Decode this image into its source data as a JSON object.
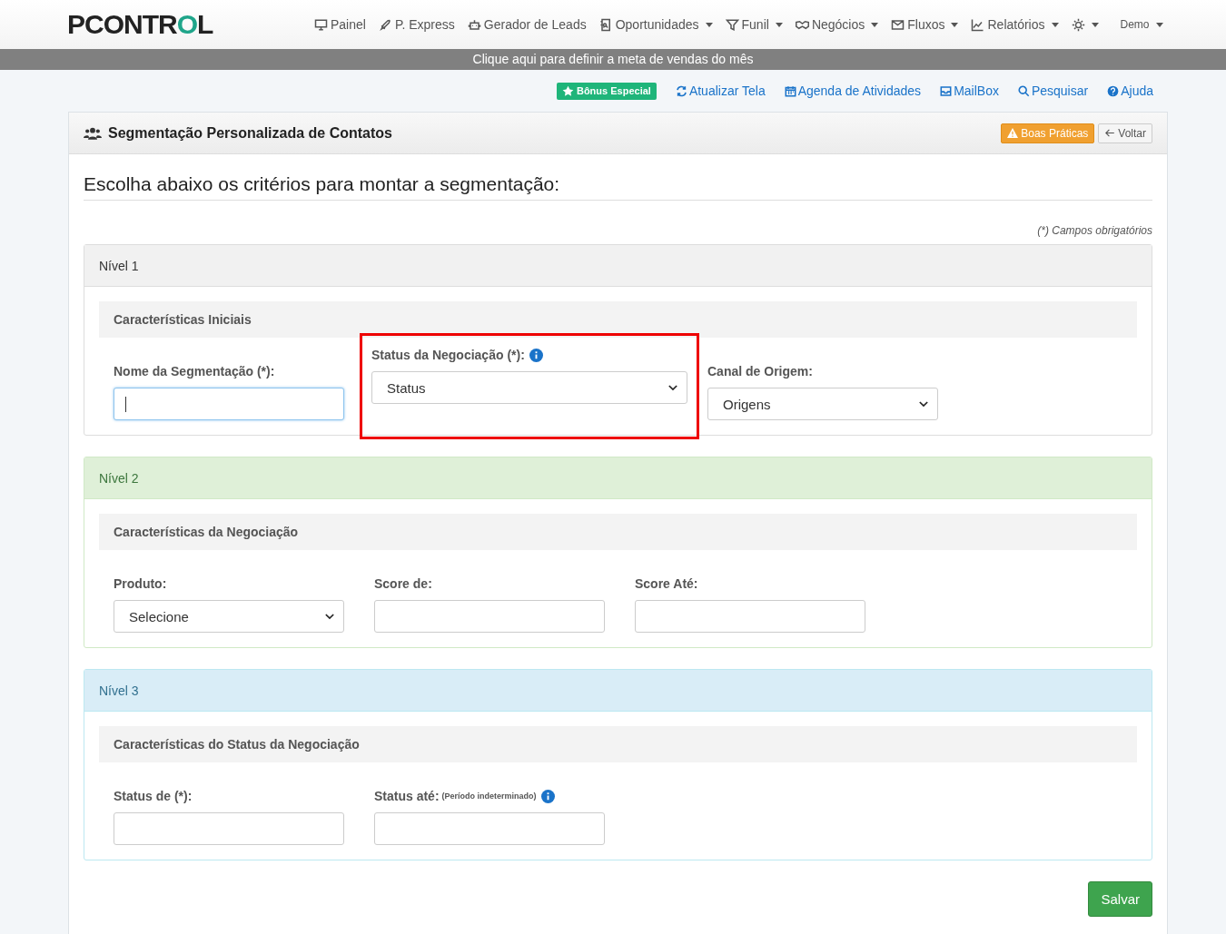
{
  "logo": {
    "text": "PCONTROL"
  },
  "nav": [
    {
      "label": "Painel",
      "dropdown": false
    },
    {
      "label": "P. Express",
      "dropdown": false
    },
    {
      "label": "Gerador de Leads",
      "dropdown": false
    },
    {
      "label": "Oportunidades",
      "dropdown": true
    },
    {
      "label": "Funil",
      "dropdown": true
    },
    {
      "label": "Negócios",
      "dropdown": true
    },
    {
      "label": "Fluxos",
      "dropdown": true
    },
    {
      "label": "Relatórios",
      "dropdown": true
    },
    {
      "dropdown": true
    },
    {
      "label": "Demo",
      "dropdown": true
    }
  ],
  "banner": "Clique aqui para definir a meta de vendas do mês",
  "toolbar": [
    {
      "label": "Bônus Especial",
      "kind": "badge"
    },
    {
      "label": "Atualizar Tela",
      "kind": "link"
    },
    {
      "label": "Agenda de Atividades",
      "kind": "link"
    },
    {
      "label": "MailBox",
      "kind": "link"
    },
    {
      "label": "Pesquisar",
      "kind": "link"
    },
    {
      "label": "Ajuda",
      "kind": "link"
    }
  ],
  "card": {
    "title": "Segmentação Personalizada de Contatos",
    "buttons": [
      {
        "label": "Boas Práticas",
        "kind": "warning"
      },
      {
        "label": "Voltar",
        "kind": "back"
      }
    ]
  },
  "heading": "Escolha abaixo os critérios para montar a segmentação:",
  "required_note": "(*) Campos obrigatórios",
  "levels": [
    {
      "title": "Nível 1",
      "kind": "default",
      "subtitle": "Características Iniciais",
      "fields": [
        {
          "label": "Nome da Segmentação (*):",
          "kind": "text",
          "focused": true,
          "wide": false,
          "highlighted": false,
          "info": false
        },
        {
          "label": "Status da Negociação (*):",
          "kind": "select",
          "value": "Status",
          "wide": true,
          "highlighted": true,
          "info": true
        },
        {
          "label": "Canal de Origem:",
          "kind": "select",
          "value": "Origens",
          "wide": false,
          "highlighted": false,
          "info": false
        }
      ]
    },
    {
      "title": "Nível 2",
      "kind": "success",
      "subtitle": "Características da Negociação",
      "fields": [
        {
          "label": "Produto:",
          "kind": "select",
          "value": "Selecione",
          "wide": false,
          "highlighted": false,
          "info": false
        },
        {
          "label": "Score de:",
          "kind": "text",
          "focused": false,
          "wide": false,
          "highlighted": false,
          "info": false
        },
        {
          "label": "Score Até:",
          "kind": "text",
          "focused": false,
          "wide": false,
          "highlighted": false,
          "info": false
        }
      ]
    },
    {
      "title": "Nível 3",
      "kind": "info",
      "subtitle": "Características do Status da Negociação",
      "fields": [
        {
          "label": "Status de (*):",
          "kind": "text",
          "focused": false,
          "wide": false,
          "highlighted": false,
          "info": false
        },
        {
          "label": "Status até:",
          "note": "(Período indeterminado)",
          "kind": "text",
          "focused": false,
          "wide": false,
          "highlighted": false,
          "info": true
        }
      ]
    }
  ],
  "save_button": "Salvar"
}
